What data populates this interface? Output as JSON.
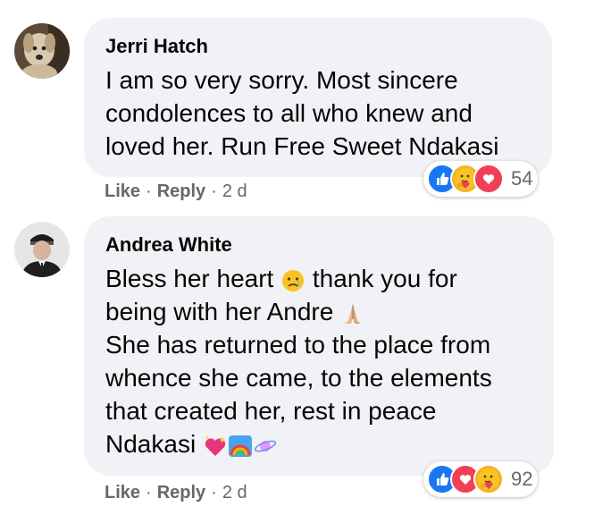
{
  "comments": [
    {
      "author": "Jerri Hatch",
      "lines": [
        "I am so very sorry. Most sincere",
        "condolences to all who knew and",
        "loved her. Run Free Sweet Ndakasi"
      ],
      "actions": {
        "like": "Like",
        "reply": "Reply",
        "dot1": "·",
        "dot2": "·",
        "time": "2 d"
      },
      "reactions": {
        "icons": [
          "like-icon",
          "care-icon",
          "love-icon"
        ],
        "count": "54"
      }
    },
    {
      "author": "Andrea White",
      "lines": {
        "l1a": "Bless her heart",
        "l1b": "thank you for",
        "l2": "being with her Andre",
        "l3": "She has returned to the place from",
        "l4": "whence she came, to the elements",
        "l5": "that created her, rest in peace",
        "l6": "Ndakasi"
      },
      "emojis": [
        "crying-face-emoji",
        "folded-hands-emoji",
        "sparkling-heart-emoji",
        "rainbow-emoji",
        "ringed-planet-emoji"
      ],
      "actions": {
        "like": "Like",
        "reply": "Reply",
        "dot1": "·",
        "dot2": "·",
        "time": "2 d"
      },
      "reactions": {
        "icons": [
          "like-icon",
          "love-icon",
          "care-icon"
        ],
        "count": "92"
      }
    }
  ],
  "colors": {
    "bubble": "#f0f2f5",
    "like": "#1877f2",
    "love": "#f33e58",
    "care": "#f7b125",
    "meta": "#65676b"
  }
}
